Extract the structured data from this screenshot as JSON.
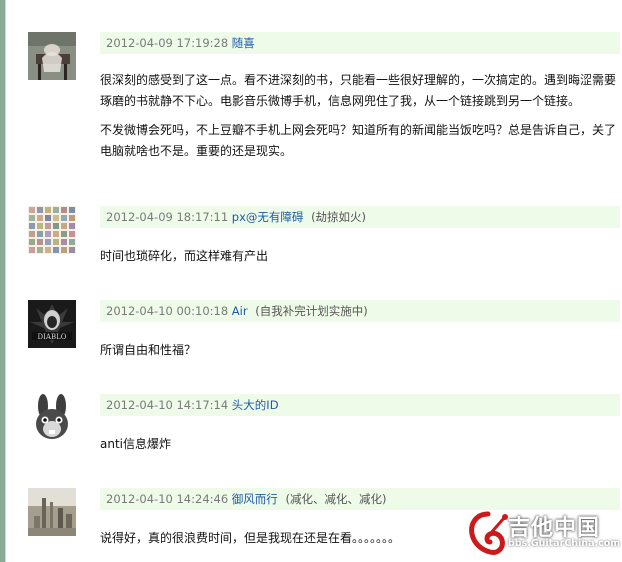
{
  "comments": [
    {
      "timestamp": "2012-04-09 17:19:28",
      "username": "随喜",
      "note": "",
      "paragraphs": [
        "很深刻的感受到了这一点。看不进深刻的书，只能看一些很好理解的，一次搞定的。遇到晦涩需要琢磨的书就静不下心。电影音乐微博手机，信息网兜住了我，从一个链接跳到另一个链接。",
        "不发微博会死吗，不上豆瓣不手机上网会死吗？知道所有的新闻能当饭吃吗？总是告诉自己，关了电脑就啥也不是。重要的还是现实。"
      ]
    },
    {
      "timestamp": "2012-04-09 18:17:11",
      "username": "px@无有障碍",
      "note": "(劫掠如火)",
      "paragraphs": [
        "时间也琐碎化，而这样难有产出"
      ]
    },
    {
      "timestamp": "2012-04-10 00:10:18",
      "username": "Air",
      "note": "(自我补完计划实施中)",
      "paragraphs": [
        "所谓自由和性福？"
      ]
    },
    {
      "timestamp": "2012-04-10 14:17:14",
      "username": "头大的ID",
      "note": "",
      "paragraphs": [
        "anti信息爆炸"
      ]
    },
    {
      "timestamp": "2012-04-10 14:24:46",
      "username": "御风而行",
      "note": "(减化、减化、减化)",
      "paragraphs": [
        "说得好，真的很浪费时间，但是我现在还是在看。。。。。。。"
      ]
    }
  ],
  "watermark": {
    "title": "吉他中国",
    "url": "bbs.GuitarChina.com"
  },
  "colors": {
    "meta_bg": "#eefbe9",
    "username": "#1e5aa8",
    "timestamp": "#7a7a7a",
    "frame": "#8cab96"
  }
}
